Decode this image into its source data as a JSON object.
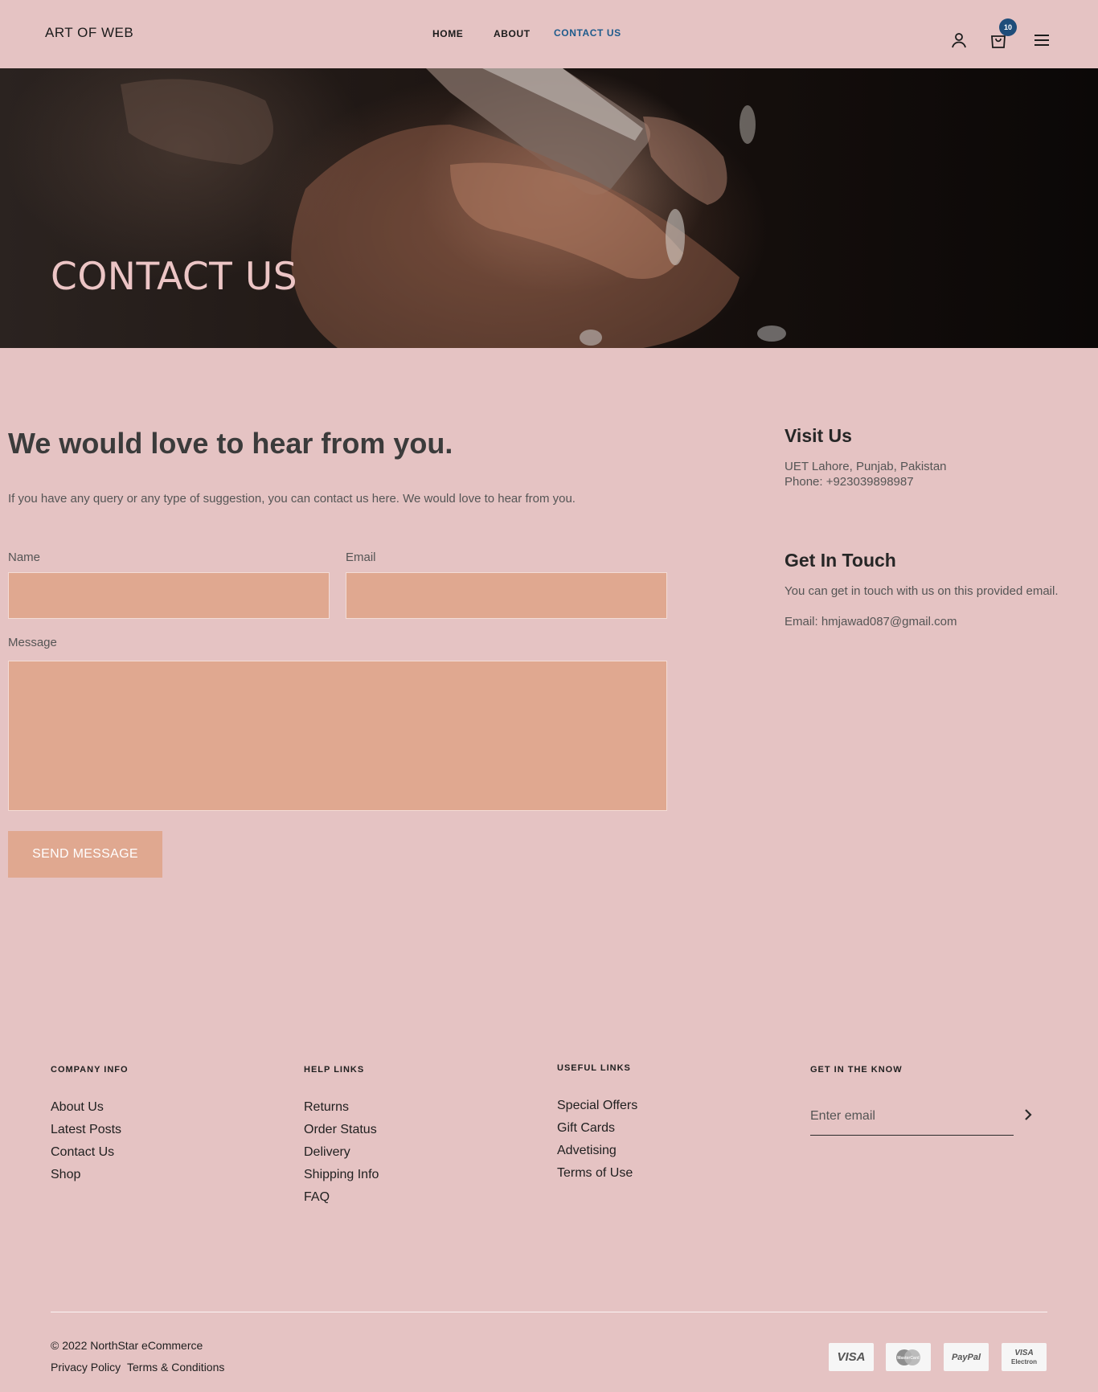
{
  "header": {
    "logo": "ART OF WEB",
    "nav": {
      "home": "HOME",
      "about": "ABOUT",
      "contact": "CONTACT US"
    },
    "cart_count": "10",
    "icons": [
      "user-icon",
      "cart-icon",
      "menu-icon"
    ]
  },
  "hero": {
    "title": "CONTACT US"
  },
  "main": {
    "heading": "We would love to hear from you.",
    "intro": "If you have any query or any type of suggestion, you can contact us here. We would love to hear from you.",
    "form": {
      "name_label": "Name",
      "email_label": "Email",
      "message_label": "Message",
      "name_value": "",
      "email_value": "",
      "message_value": "",
      "submit_label": "SEND MESSAGE"
    }
  },
  "sidebar": {
    "visit": {
      "title": "Visit Us",
      "address": "UET Lahore, Punjab, Pakistan",
      "phone": "Phone: +923039898987"
    },
    "touch": {
      "title": "Get In Touch",
      "text": "You can get in touch with us on this provided email.",
      "email": "Email: hmjawad087@gmail.com"
    }
  },
  "footer": {
    "company": {
      "title": "COMPANY INFO",
      "links": [
        "About Us",
        "Latest Posts",
        "Contact Us",
        "Shop"
      ]
    },
    "help": {
      "title": "HELP LINKS",
      "links": [
        "Returns",
        "Order Status",
        "Delivery",
        "Shipping Info",
        "FAQ"
      ]
    },
    "useful": {
      "title": "USEFUL LINKS",
      "links": [
        "Special Offers",
        "Gift Cards",
        "Advetising",
        "Terms of Use"
      ]
    },
    "know": {
      "title": "GET IN THE KNOW",
      "placeholder": "Enter email"
    },
    "copyright": "© 2022 NorthStar eCommerce",
    "legal": {
      "privacy": "Privacy Policy",
      "terms": "Terms & Conditions"
    },
    "payments": {
      "visa": "VISA",
      "mastercard": "MasterCard",
      "paypal": "PayPal",
      "visa_electron_top": "VISA",
      "visa_electron_bottom": "Electron"
    }
  },
  "colors": {
    "background": "#e5c3c3",
    "accent": "#e0a890",
    "nav_active": "#1e5b8c",
    "badge": "#1e4d7a",
    "hero_title": "#ecc5c5"
  }
}
